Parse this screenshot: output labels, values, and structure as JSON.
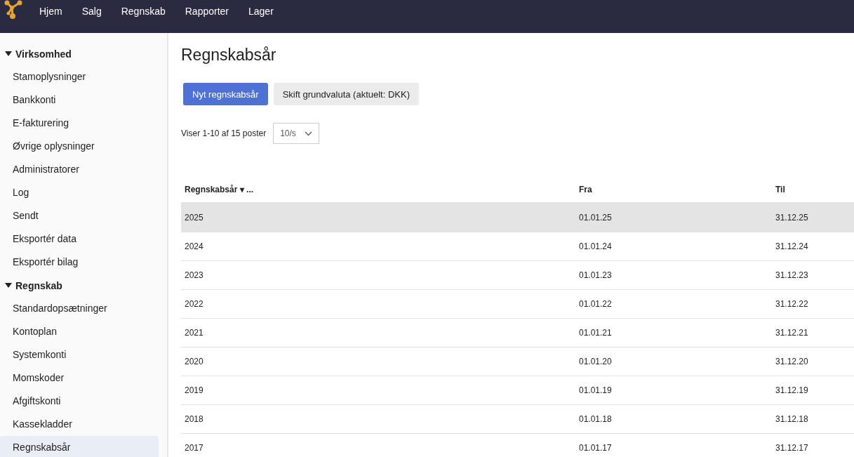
{
  "nav": {
    "items": [
      "Hjem",
      "Salg",
      "Regnskab",
      "Rapporter",
      "Lager"
    ]
  },
  "sidebar": {
    "groups": [
      {
        "label": "Virksomhed",
        "expanded": true,
        "children": [
          {
            "label": "Stamoplysninger",
            "selected": false
          },
          {
            "label": "Bankkonti",
            "selected": false
          },
          {
            "label": "E-fakturering",
            "selected": false
          },
          {
            "label": "Øvrige oplysninger",
            "selected": false
          },
          {
            "label": "Administratorer",
            "selected": false
          },
          {
            "label": "Log",
            "selected": false
          },
          {
            "label": "Sendt",
            "selected": false
          },
          {
            "label": "Eksportér data",
            "selected": false
          },
          {
            "label": "Eksportér bilag",
            "selected": false
          }
        ]
      },
      {
        "label": "Regnskab",
        "expanded": true,
        "children": [
          {
            "label": "Standardopsætninger",
            "selected": false
          },
          {
            "label": "Kontoplan",
            "selected": false
          },
          {
            "label": "Systemkonti",
            "selected": false
          },
          {
            "label": "Momskoder",
            "selected": false
          },
          {
            "label": "Afgiftskonti",
            "selected": false
          },
          {
            "label": "Kassekladder",
            "selected": false
          },
          {
            "label": "Regnskabsår",
            "selected": true
          }
        ]
      }
    ]
  },
  "page": {
    "title": "Regnskabsår",
    "buttons": [
      {
        "label": "Nyt regnskabsår",
        "kind": "primary"
      },
      {
        "label": "Skift grundvaluta (aktuelt: DKK)",
        "kind": "secondary"
      }
    ],
    "paging": {
      "text": "Viser 1-10 af 15 poster",
      "page_size": "10/s"
    }
  },
  "table": {
    "columns": [
      {
        "label": "Regnskabsår",
        "sort_mark": "▾ ..."
      },
      {
        "label": "Fra"
      },
      {
        "label": "Til"
      }
    ],
    "rows": [
      {
        "cells": [
          "2025",
          "01.01.25",
          "31.12.25"
        ],
        "selected": true
      },
      {
        "cells": [
          "2024",
          "01.01.24",
          "31.12.24"
        ],
        "selected": false
      },
      {
        "cells": [
          "2023",
          "01.01.23",
          "31.12.23"
        ],
        "selected": false
      },
      {
        "cells": [
          "2022",
          "01.01.22",
          "31.12.22"
        ],
        "selected": false
      },
      {
        "cells": [
          "2021",
          "01.01.21",
          "31.12.21"
        ],
        "selected": false
      },
      {
        "cells": [
          "2020",
          "01.01.20",
          "31.12.20"
        ],
        "selected": false
      },
      {
        "cells": [
          "2019",
          "01.01.19",
          "31.12.19"
        ],
        "selected": false
      },
      {
        "cells": [
          "2018",
          "01.01.18",
          "31.12.18"
        ],
        "selected": false
      },
      {
        "cells": [
          "2017",
          "01.01.17",
          "31.12.17"
        ],
        "selected": false
      }
    ]
  }
}
